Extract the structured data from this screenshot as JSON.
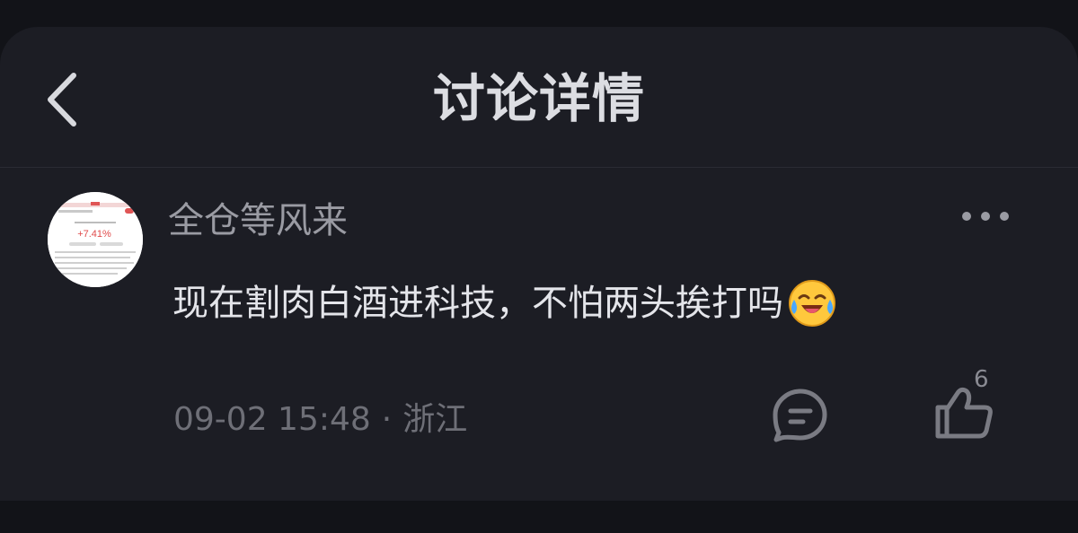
{
  "header": {
    "title": "讨论详情",
    "back_icon": "chevron-left-icon"
  },
  "post": {
    "author": "全仓等风来",
    "avatar": {
      "description_icon": "stock-screenshot-avatar",
      "mini_pct": "+7.41%"
    },
    "more_icon": "ellipsis-icon",
    "content": "现在割肉白酒进科技，不怕两头挨打吗",
    "emoji_icon": "crying-laughing-emoji-icon",
    "date": "09-02 15:48",
    "separator": "·",
    "location": "浙江",
    "comment_icon": "comment-bubble-icon",
    "like_icon": "thumbs-up-icon",
    "like_count": "6"
  },
  "colors": {
    "background": "#121318",
    "card": "#1c1d24",
    "title": "#dcdde2",
    "author": "#9a9ba3",
    "content": "#e4e5ea",
    "meta": "#6e6f77",
    "icon": "#7a7b83",
    "emoji": "#ffc83d"
  }
}
